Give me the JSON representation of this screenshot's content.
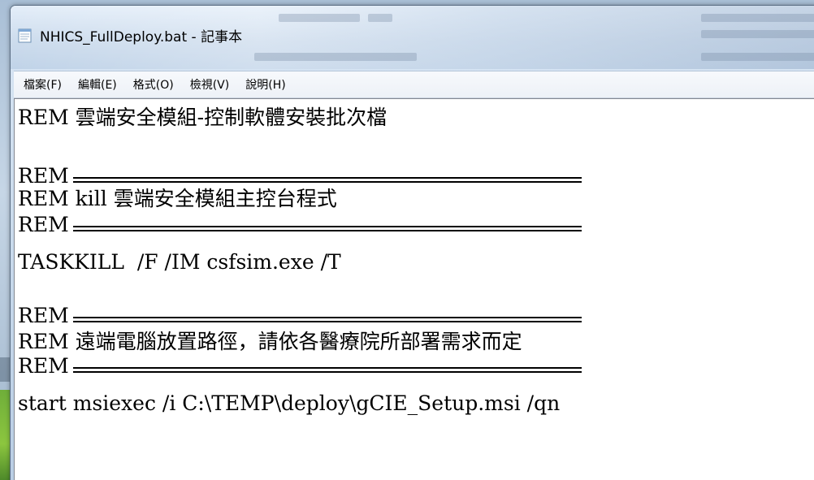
{
  "window": {
    "title": "NHICS_FullDeploy.bat - 記事本"
  },
  "menu": {
    "items": [
      "檔案(F)",
      "編輯(E)",
      "格式(O)",
      "檢視(V)",
      "說明(H)"
    ]
  },
  "document": {
    "lines": [
      "REM 雲端安全模組-控制軟體安裝批次檔",
      "REM ",
      "REM kill 雲端安全模組主控台程式",
      "REM ",
      "TASKKILL  /F /IM csfsim.exe /T",
      "REM ",
      "REM 遠端電腦放置路徑，請依各醫療院所部署需求而定",
      "REM ",
      "start msiexec /i C:\\TEMP\\deploy\\gCIE_Setup.msi /qn"
    ]
  },
  "icons": {
    "app": "notepad-icon"
  }
}
